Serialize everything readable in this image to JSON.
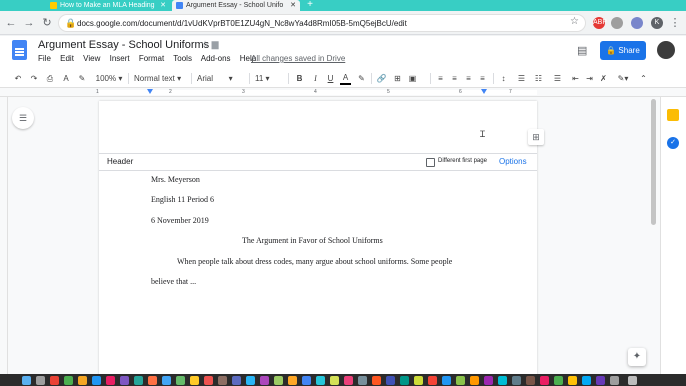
{
  "browser": {
    "tabs": [
      {
        "title": "How to Make an MLA Heading",
        "active": false
      },
      {
        "title": "Argument Essay - School Unifo",
        "active": true
      }
    ],
    "url": "docs.google.com/document/d/1vUdKVprBT0E1ZU4gN_Nc8wYa4d8RmI05B-5mQ5ejBcU/edit",
    "extensions": [
      "ABP",
      "K"
    ]
  },
  "docs": {
    "title": "Argument Essay - School Uniforms",
    "menu": [
      "File",
      "Edit",
      "View",
      "Insert",
      "Format",
      "Tools",
      "Add-ons",
      "Help"
    ],
    "save_status": "All changes saved in Drive",
    "share_label": "Share",
    "toolbar": {
      "zoom": "100%",
      "style": "Normal text",
      "font": "Arial",
      "font_size": "11"
    },
    "ruler_numbers": [
      "1",
      "2",
      "3",
      "4",
      "5",
      "6",
      "7"
    ],
    "header_bar": {
      "label": "Header",
      "different_first_page": "Different first page",
      "options": "Options"
    },
    "document_lines": {
      "teacher": "Mrs. Meyerson",
      "class": "English 11 Period 6",
      "date": "6 November 2019",
      "title": "The Argument in Favor of School Uniforms",
      "para1": "When people talk about dress codes, many argue about school uniforms. Some people",
      "para2": "believe that ..."
    }
  },
  "colors": {
    "tab_strip": "#38cec4",
    "share_button": "#1a73e8",
    "docs_blue": "#4285f4"
  }
}
